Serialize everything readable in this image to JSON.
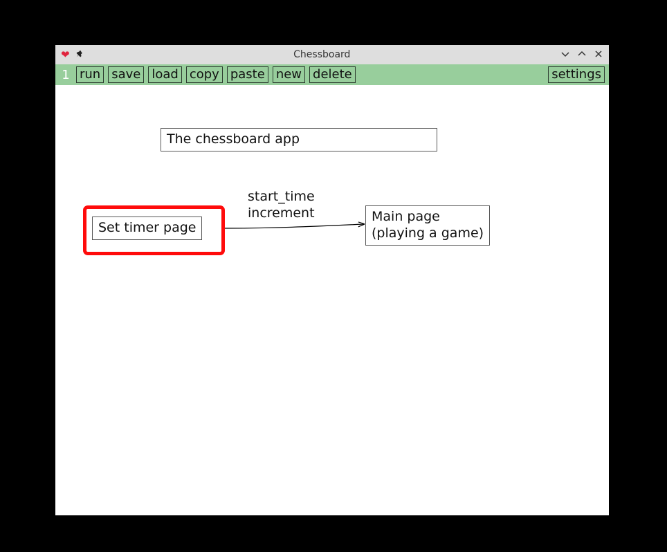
{
  "window": {
    "title": "Chessboard"
  },
  "toolbar": {
    "index": "1",
    "buttons": {
      "run": "run",
      "save": "save",
      "load": "load",
      "copy": "copy",
      "paste": "paste",
      "new": "new",
      "delete": "delete",
      "settings": "settings"
    }
  },
  "nodes": {
    "title_box": "The chessboard app",
    "set_timer": "Set timer page",
    "main_page": "Main page\n(playing a game)"
  },
  "edges": {
    "timer_to_main": "start_time\nincrement"
  }
}
